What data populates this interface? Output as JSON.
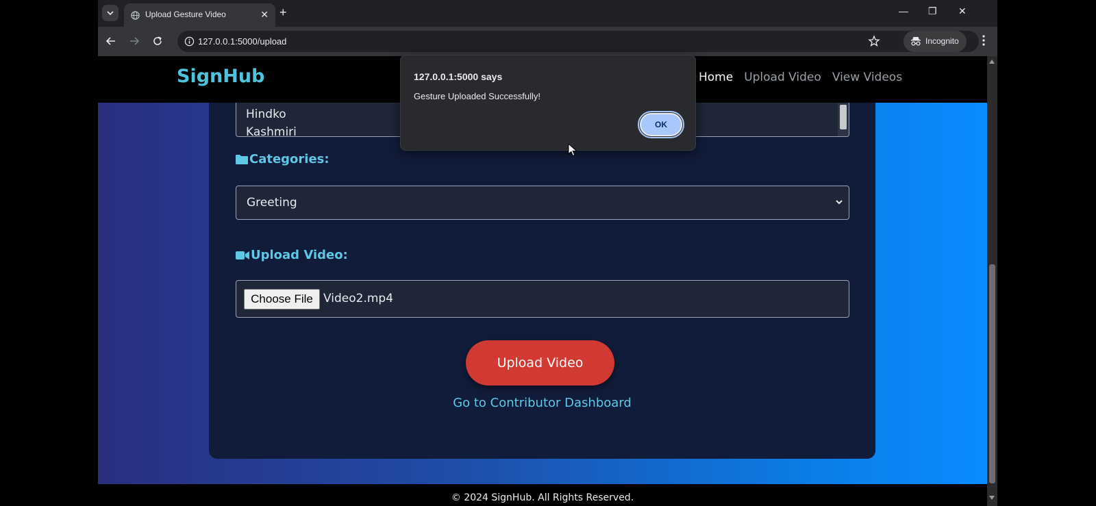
{
  "browser": {
    "tab_title": "Upload Gesture Video",
    "url": "127.0.0.1:5000/upload",
    "profile_label": "Incognito"
  },
  "site": {
    "logo": "SignHub",
    "nav": {
      "home": "Home",
      "upload_video": "Upload Video",
      "view_videos": "View Videos"
    }
  },
  "form": {
    "languages_lines": [
      "Hindko",
      "Kashmiri"
    ],
    "categories_label": "Categories:",
    "category_value": "Greeting",
    "upload_label": "Upload Video:",
    "choose_file_label": "Choose File",
    "file_name": "Video2.mp4",
    "submit_label": "Upload Video",
    "dashboard_link": "Go to Contributor Dashboard"
  },
  "footer": {
    "text": "© 2024 SignHub. All Rights Reserved."
  },
  "alert": {
    "title": "127.0.0.1:5000 says",
    "message": "Gesture Uploaded Successfully!",
    "ok_label": "OK"
  },
  "colors": {
    "accent": "#4fc3dc",
    "submit": "#d03a33",
    "dialog_button": "#a8c7fa"
  }
}
